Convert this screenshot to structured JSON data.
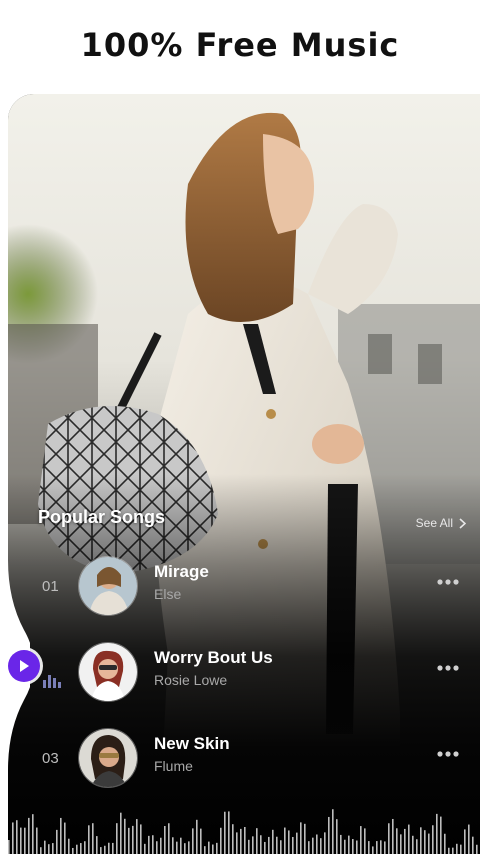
{
  "headline": "100% Free Music",
  "section": {
    "title": "Popular Songs",
    "see_all": "See All"
  },
  "songs": [
    {
      "number": "01",
      "title": "Mirage",
      "artist": "Else",
      "playing": false
    },
    {
      "number": "",
      "title": "Worry Bout Us",
      "artist": "Rosie Lowe",
      "playing": true
    },
    {
      "number": "03",
      "title": "New Skin",
      "artist": "Flume",
      "playing": false
    }
  ],
  "colors": {
    "accent": "#6a26e8",
    "background": "#000000",
    "text_primary": "#ffffff",
    "text_secondary": "#a8a8a8"
  },
  "icons": {
    "play": "play-icon",
    "more": "more-dots-icon",
    "chevron": "chevron-right-icon",
    "equalizer": "equalizer-icon"
  }
}
